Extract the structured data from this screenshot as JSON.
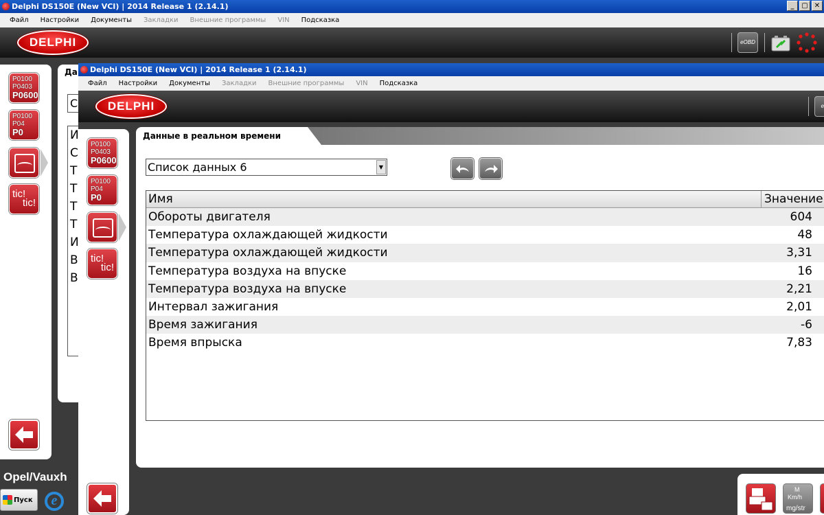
{
  "window": {
    "title": "Delphi DS150E (New VCI) | 2014 Release 1 (2.14.1)",
    "controls": [
      "_",
      "▢",
      "✕"
    ]
  },
  "menu": [
    {
      "label": "Файл",
      "enabled": true
    },
    {
      "label": "Настройки",
      "enabled": true
    },
    {
      "label": "Документы",
      "enabled": true
    },
    {
      "label": "Закладки",
      "enabled": false
    },
    {
      "label": "Внешние программы",
      "enabled": false
    },
    {
      "label": "VIN",
      "enabled": false
    },
    {
      "label": "Подсказка",
      "enabled": true
    }
  ],
  "brand": {
    "logo_text": "DELPHI",
    "eobd_label": "eOBD",
    "eobd_label_cut": "eO"
  },
  "sidebar": {
    "dtc_codes": [
      "P0100",
      "P0403",
      "P0600"
    ],
    "clear_codes": [
      "P0100",
      "P04",
      "P0"
    ],
    "tic_labels": [
      "tic!",
      "tic!"
    ]
  },
  "background_window": {
    "tab_peek": "Да",
    "dropdown_peek": "С",
    "list_peek": [
      "И",
      "С",
      "Т",
      "Т",
      "Т",
      "Т",
      "И",
      "В",
      "В"
    ],
    "vehicle": "Opel/Vauxh"
  },
  "tab": {
    "label": "Данные в реальном времени"
  },
  "dropdown": {
    "selected": "Список данных 6",
    "arrow": "▼"
  },
  "table": {
    "headers": {
      "name": "Имя",
      "value": "Значение"
    },
    "rows": [
      {
        "name": "Обороты двигателя",
        "value": "604"
      },
      {
        "name": "Температура охлаждающей жидкости",
        "value": "48"
      },
      {
        "name": "Температура охлаждающей жидкости",
        "value": "3,31"
      },
      {
        "name": "Температура воздуха на впуске",
        "value": "16"
      },
      {
        "name": "Температура воздуха на впуске",
        "value": "2,21"
      },
      {
        "name": "Интервал зажигания",
        "value": "2,01"
      },
      {
        "name": "Время зажигания",
        "value": "-6"
      },
      {
        "name": "Время впрыска",
        "value": "7,83"
      }
    ]
  },
  "graph_tool": {
    "units": [
      "M",
      "Km/h",
      "mg/str"
    ]
  },
  "taskbar": {
    "start_label": "Пуск",
    "ie_glyph": "e"
  },
  "colors": {
    "accent_red": "#c40000",
    "title_blue": "#0a3fa8",
    "brand_dark": "#121212"
  }
}
